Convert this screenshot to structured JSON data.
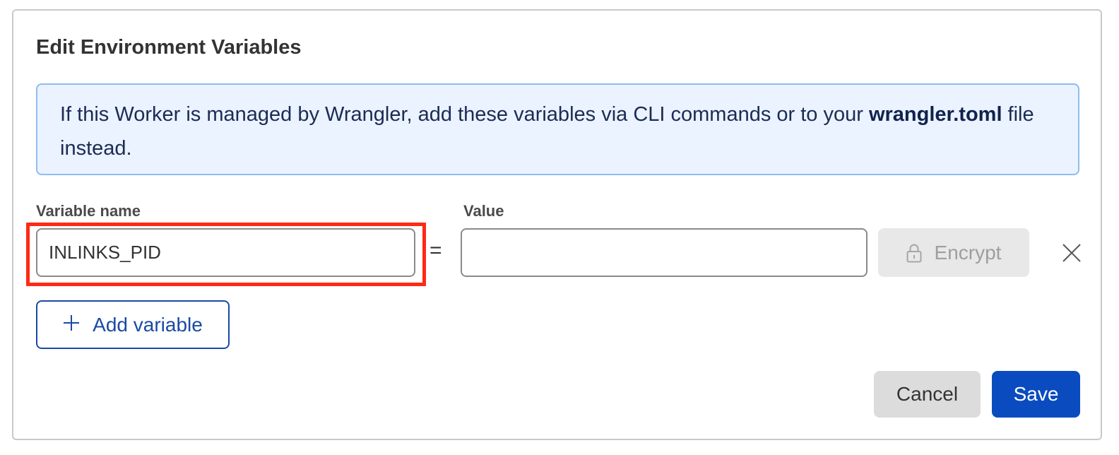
{
  "dialog": {
    "title": "Edit Environment Variables"
  },
  "notice": {
    "text_before": "If this Worker is managed by Wrangler, add these variables via CLI commands or to your ",
    "filename": "wrangler.toml",
    "text_after": " file instead."
  },
  "form": {
    "name_label": "Variable name",
    "value_label": "Value",
    "equals_sign": "=",
    "rows": [
      {
        "name_value": "INLINKS_PID",
        "value_value": "",
        "encrypt_label": "Encrypt",
        "encrypt_icon": "lock-icon",
        "remove_icon": "close-icon"
      }
    ],
    "add_variable_label": "Add variable",
    "add_icon": "plus-icon"
  },
  "footer": {
    "cancel_label": "Cancel",
    "save_label": "Save"
  },
  "colors": {
    "primary": "#0a4cc0",
    "info_background": "#eaf3ff",
    "info_border": "#8fbdf0",
    "highlight": "#ff2a14",
    "disabled_button": "#e8e8e8"
  }
}
